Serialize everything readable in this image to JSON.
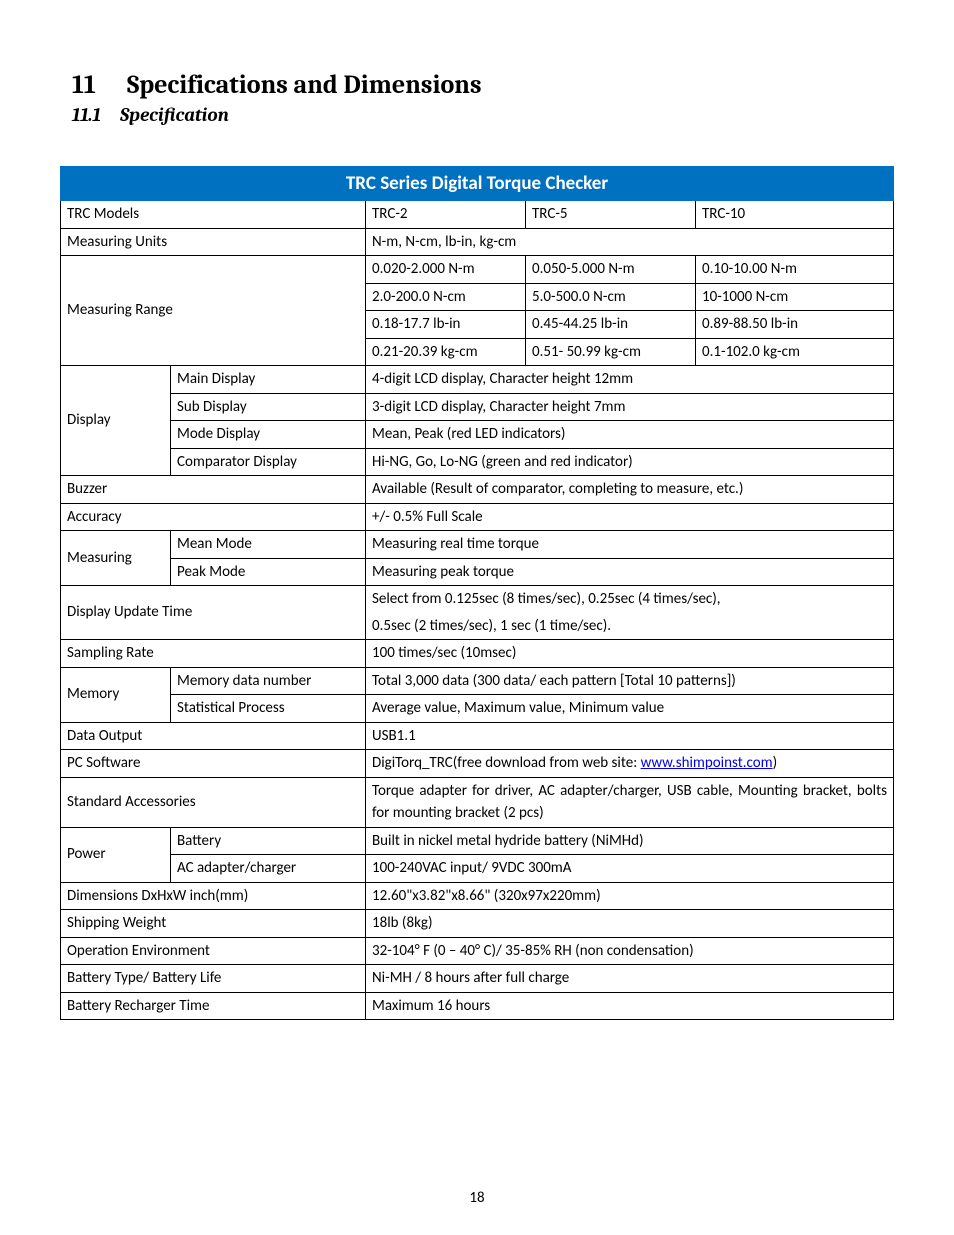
{
  "heading": {
    "num": "11",
    "title": "Specifications and Dimensions"
  },
  "subheading": {
    "num": "11.1",
    "title": "Specification"
  },
  "tableTitle": "TRC Series Digital Torque Checker",
  "rows": {
    "models": {
      "label": "TRC Models",
      "c1": "TRC-2",
      "c2": "TRC-5",
      "c3": "TRC-10"
    },
    "units": {
      "label": "Measuring Units",
      "val": "N-m, N-cm, lb-in, kg-cm"
    },
    "range": {
      "label": "Measuring Range",
      "r1": {
        "a": "0.020-2.000 N-m",
        "b": "0.050-5.000 N-m",
        "c": "0.10-10.00 N-m"
      },
      "r2": {
        "a": "2.0-200.0 N-cm",
        "b": "5.0-500.0 N-cm",
        "c": "10-1000 N-cm"
      },
      "r3": {
        "a": "0.18-17.7 lb-in",
        "b": "0.45-44.25 lb-in",
        "c": "0.89-88.50 lb-in"
      },
      "r4": {
        "a": "0.21-20.39 kg-cm",
        "b": "0.51- 50.99 kg-cm",
        "c": "0.1-102.0 kg-cm"
      }
    },
    "display": {
      "label": "Display",
      "main": {
        "k": "Main Display",
        "v": "4-digit LCD display, Character height 12mm"
      },
      "sub": {
        "k": "Sub Display",
        "v": "3-digit LCD display, Character height 7mm"
      },
      "mode": {
        "k": "Mode Display",
        "v": "Mean, Peak (red LED indicators)"
      },
      "comp": {
        "k": "Comparator Display",
        "v": "Hi-NG, Go, Lo-NG (green and red indicator)"
      }
    },
    "buzzer": {
      "label": "Buzzer",
      "val": "Available (Result of comparator, completing to measure, etc.)"
    },
    "accuracy": {
      "label": "Accuracy",
      "val": "+/- 0.5% Full Scale"
    },
    "measuring": {
      "label": "Measuring",
      "mean": {
        "k": "Mean Mode",
        "v": "Measuring real time torque"
      },
      "peak": {
        "k": "Peak Mode",
        "v": "Measuring peak torque"
      }
    },
    "update": {
      "label": "Display Update Time",
      "v1": "Select from 0.125sec (8 times/sec), 0.25sec (4 times/sec),",
      "v2": "0.5sec (2 times/sec), 1 sec (1 time/sec)."
    },
    "sampling": {
      "label": "Sampling Rate",
      "val": "100 times/sec (10msec)"
    },
    "memory": {
      "label": "Memory",
      "num": {
        "k": "Memory data number",
        "v": "Total 3,000 data (300 data/ each pattern [Total 10 patterns])"
      },
      "stat": {
        "k": "Statistical Process",
        "v": "Average value, Maximum value, Minimum value"
      }
    },
    "dataout": {
      "label": "Data Output",
      "val": "USB1.1"
    },
    "pcsoft": {
      "label": "PC Software",
      "pre": "DigiTorq_TRC(free download from web site: ",
      "link": "www.shimpoinst.com",
      "post": ")"
    },
    "acc": {
      "label": "Standard Accessories",
      "val": "Torque adapter for driver, AC adapter/charger, USB cable, Mounting bracket, bolts for mounting bracket (2 pcs)"
    },
    "power": {
      "label": "Power",
      "bat": {
        "k": "Battery",
        "v": "Built in nickel metal hydride battery (NiMHd)"
      },
      "ac": {
        "k": "AC adapter/charger",
        "v": "100-240VAC input/ 9VDC 300mA"
      }
    },
    "dim": {
      "label": "Dimensions DxHxW inch(mm)",
      "val": "12.60\"x3.82\"x8.66\" (320x97x220mm)"
    },
    "ship": {
      "label": "Shipping Weight",
      "val": "18lb (8kg)"
    },
    "openv": {
      "label": "Operation Environment",
      "val": "32-104° F (0 – 40° C)/ 35-85% RH (non condensation)"
    },
    "blife": {
      "label": "Battery Type/ Battery Life",
      "val": "Ni-MH / 8 hours after full charge"
    },
    "brech": {
      "label": "Battery Recharger Time",
      "val": "Maximum 16 hours"
    }
  },
  "pageNumber": "18"
}
